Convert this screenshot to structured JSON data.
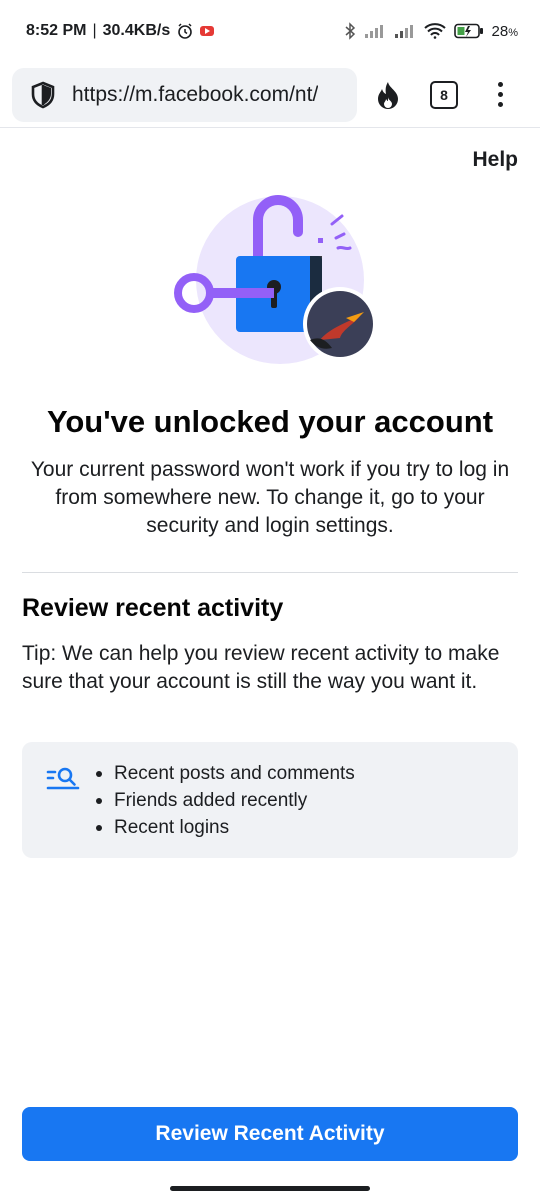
{
  "status_bar": {
    "time": "8:52 PM",
    "speed": "30.4KB/s",
    "battery": "28"
  },
  "browser": {
    "url": "https://m.facebook.com/nt/",
    "tab_count": "8"
  },
  "page": {
    "help_label": "Help",
    "title": "You've unlocked your account",
    "subtitle": "Your current password won't work if you try to log in from somewhere new. To change it, go to your security and login settings.",
    "review_heading": "Review recent activity",
    "tip": "Tip: We can help you review recent activity to make sure that your account is still the way you want it.",
    "activity_items": [
      "Recent posts and comments",
      "Friends added recently",
      "Recent logins"
    ],
    "button_label": "Review Recent Activity"
  },
  "colors": {
    "accent": "#1877f2",
    "illustration_purple": "#9360f7",
    "illustration_bg": "#ece6fd"
  },
  "icons": [
    "shield-icon",
    "fire-icon",
    "tabs-icon",
    "more-vert-icon",
    "padlock-key-illustration",
    "search-list-icon",
    "bluetooth-icon",
    "signal-icon",
    "wifi-icon",
    "battery-icon",
    "alarm-icon"
  ]
}
